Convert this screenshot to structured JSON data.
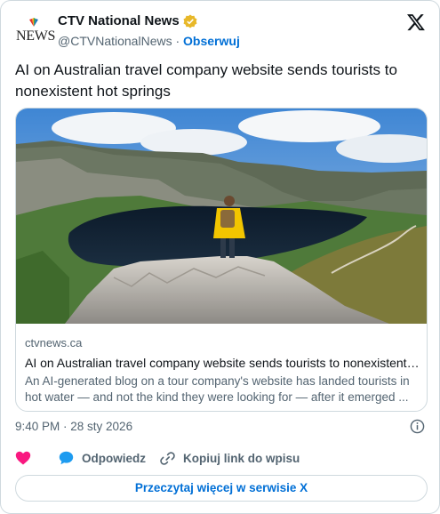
{
  "author": {
    "display_name": "CTV National News",
    "handle": "@CTVNationalNews",
    "separator": "·",
    "follow_label": "Obserwuj",
    "avatar_text": "NEWS"
  },
  "tweet": {
    "text": "AI on Australian travel company website sends tourists to nonexistent hot springs",
    "timestamp": "9:40 PM · 28 sty 2026"
  },
  "link_card": {
    "domain": "ctvnews.ca",
    "title": "AI on Australian travel company website sends tourists to nonexistent h...",
    "description": "An AI-generated blog on a tour company's website has landed tourists in hot water — and not the kind they were looking for — after it emerged ..."
  },
  "actions": {
    "reply_label": "Odpowiedz",
    "copy_link_label": "Kopiuj link do wpisu"
  },
  "read_more_label": "Przeczytaj więcej w serwisie X",
  "icons": [
    "verified-badge-icon",
    "x-logo-icon",
    "info-icon",
    "heart-icon",
    "reply-icon",
    "link-icon"
  ],
  "colors": {
    "accent": "#006fd6",
    "heart": "#f91880",
    "reply_bubble": "#1d9bf0",
    "verified": "#e8b829",
    "muted_text": "#536471",
    "border": "#cfd9de"
  }
}
